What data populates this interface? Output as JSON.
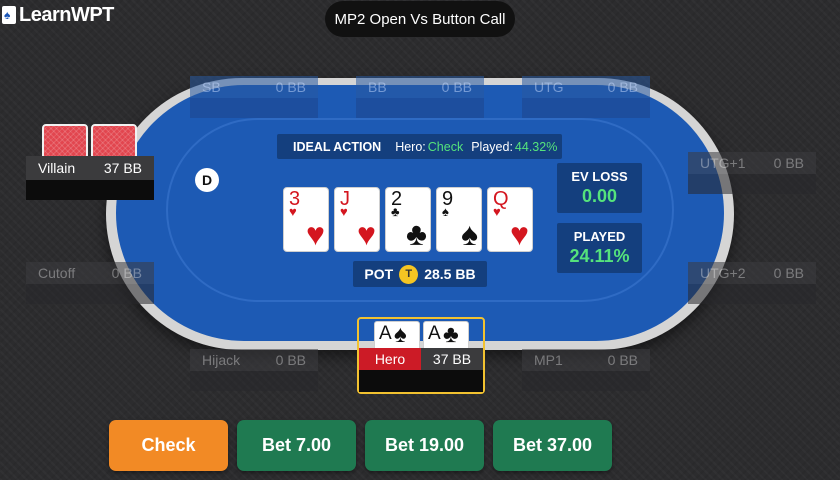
{
  "header": {
    "logo_text": "LearnWPT",
    "scenario_title": "MP2 Open Vs Button Call"
  },
  "seats": {
    "sb": {
      "name": "SB",
      "stack": "0 BB"
    },
    "bb": {
      "name": "BB",
      "stack": "0 BB"
    },
    "utg": {
      "name": "UTG",
      "stack": "0 BB"
    },
    "utg1": {
      "name": "UTG+1",
      "stack": "0 BB"
    },
    "utg2": {
      "name": "UTG+2",
      "stack": "0 BB"
    },
    "mp1": {
      "name": "MP1",
      "stack": "0 BB"
    },
    "hijack": {
      "name": "Hijack",
      "stack": "0 BB"
    },
    "cutoff": {
      "name": "Cutoff",
      "stack": "0 BB"
    }
  },
  "villain": {
    "name": "Villain",
    "stack": "37 BB"
  },
  "hero": {
    "name": "Hero",
    "stack": "37 BB",
    "cards": [
      {
        "rank": "A",
        "suit": "♠",
        "color": "#111111"
      },
      {
        "rank": "A",
        "suit": "♣",
        "color": "#111111"
      }
    ]
  },
  "dealer_button": "D",
  "ideal_action": {
    "label": "IDEAL ACTION",
    "hero_label": "Hero:",
    "hero_action": "Check",
    "played_label": "Played:",
    "played_value": "44.32%"
  },
  "board": [
    {
      "rank": "3",
      "suit": "♥",
      "color": "red"
    },
    {
      "rank": "J",
      "suit": "♥",
      "color": "red"
    },
    {
      "rank": "2",
      "suit": "♣",
      "color": "black"
    },
    {
      "rank": "9",
      "suit": "♠",
      "color": "black"
    },
    {
      "rank": "Q",
      "suit": "♥",
      "color": "red"
    }
  ],
  "pot": {
    "label": "POT",
    "chip": "T",
    "value": "28.5 BB"
  },
  "stats": {
    "ev_loss_label": "EV LOSS",
    "ev_loss_value": "0.00",
    "played_label": "PLAYED",
    "played_value": "24.11%"
  },
  "actions": {
    "check": "Check",
    "bet1": "Bet 7.00",
    "bet2": "Bet 19.00",
    "bet3": "Bet 37.00"
  },
  "colors": {
    "felt": "#1d5ab4",
    "accent_green": "#55e37c",
    "check_button": "#f28a25",
    "bet_button": "#1f7a51",
    "hero_highlight": "#f2c230"
  }
}
